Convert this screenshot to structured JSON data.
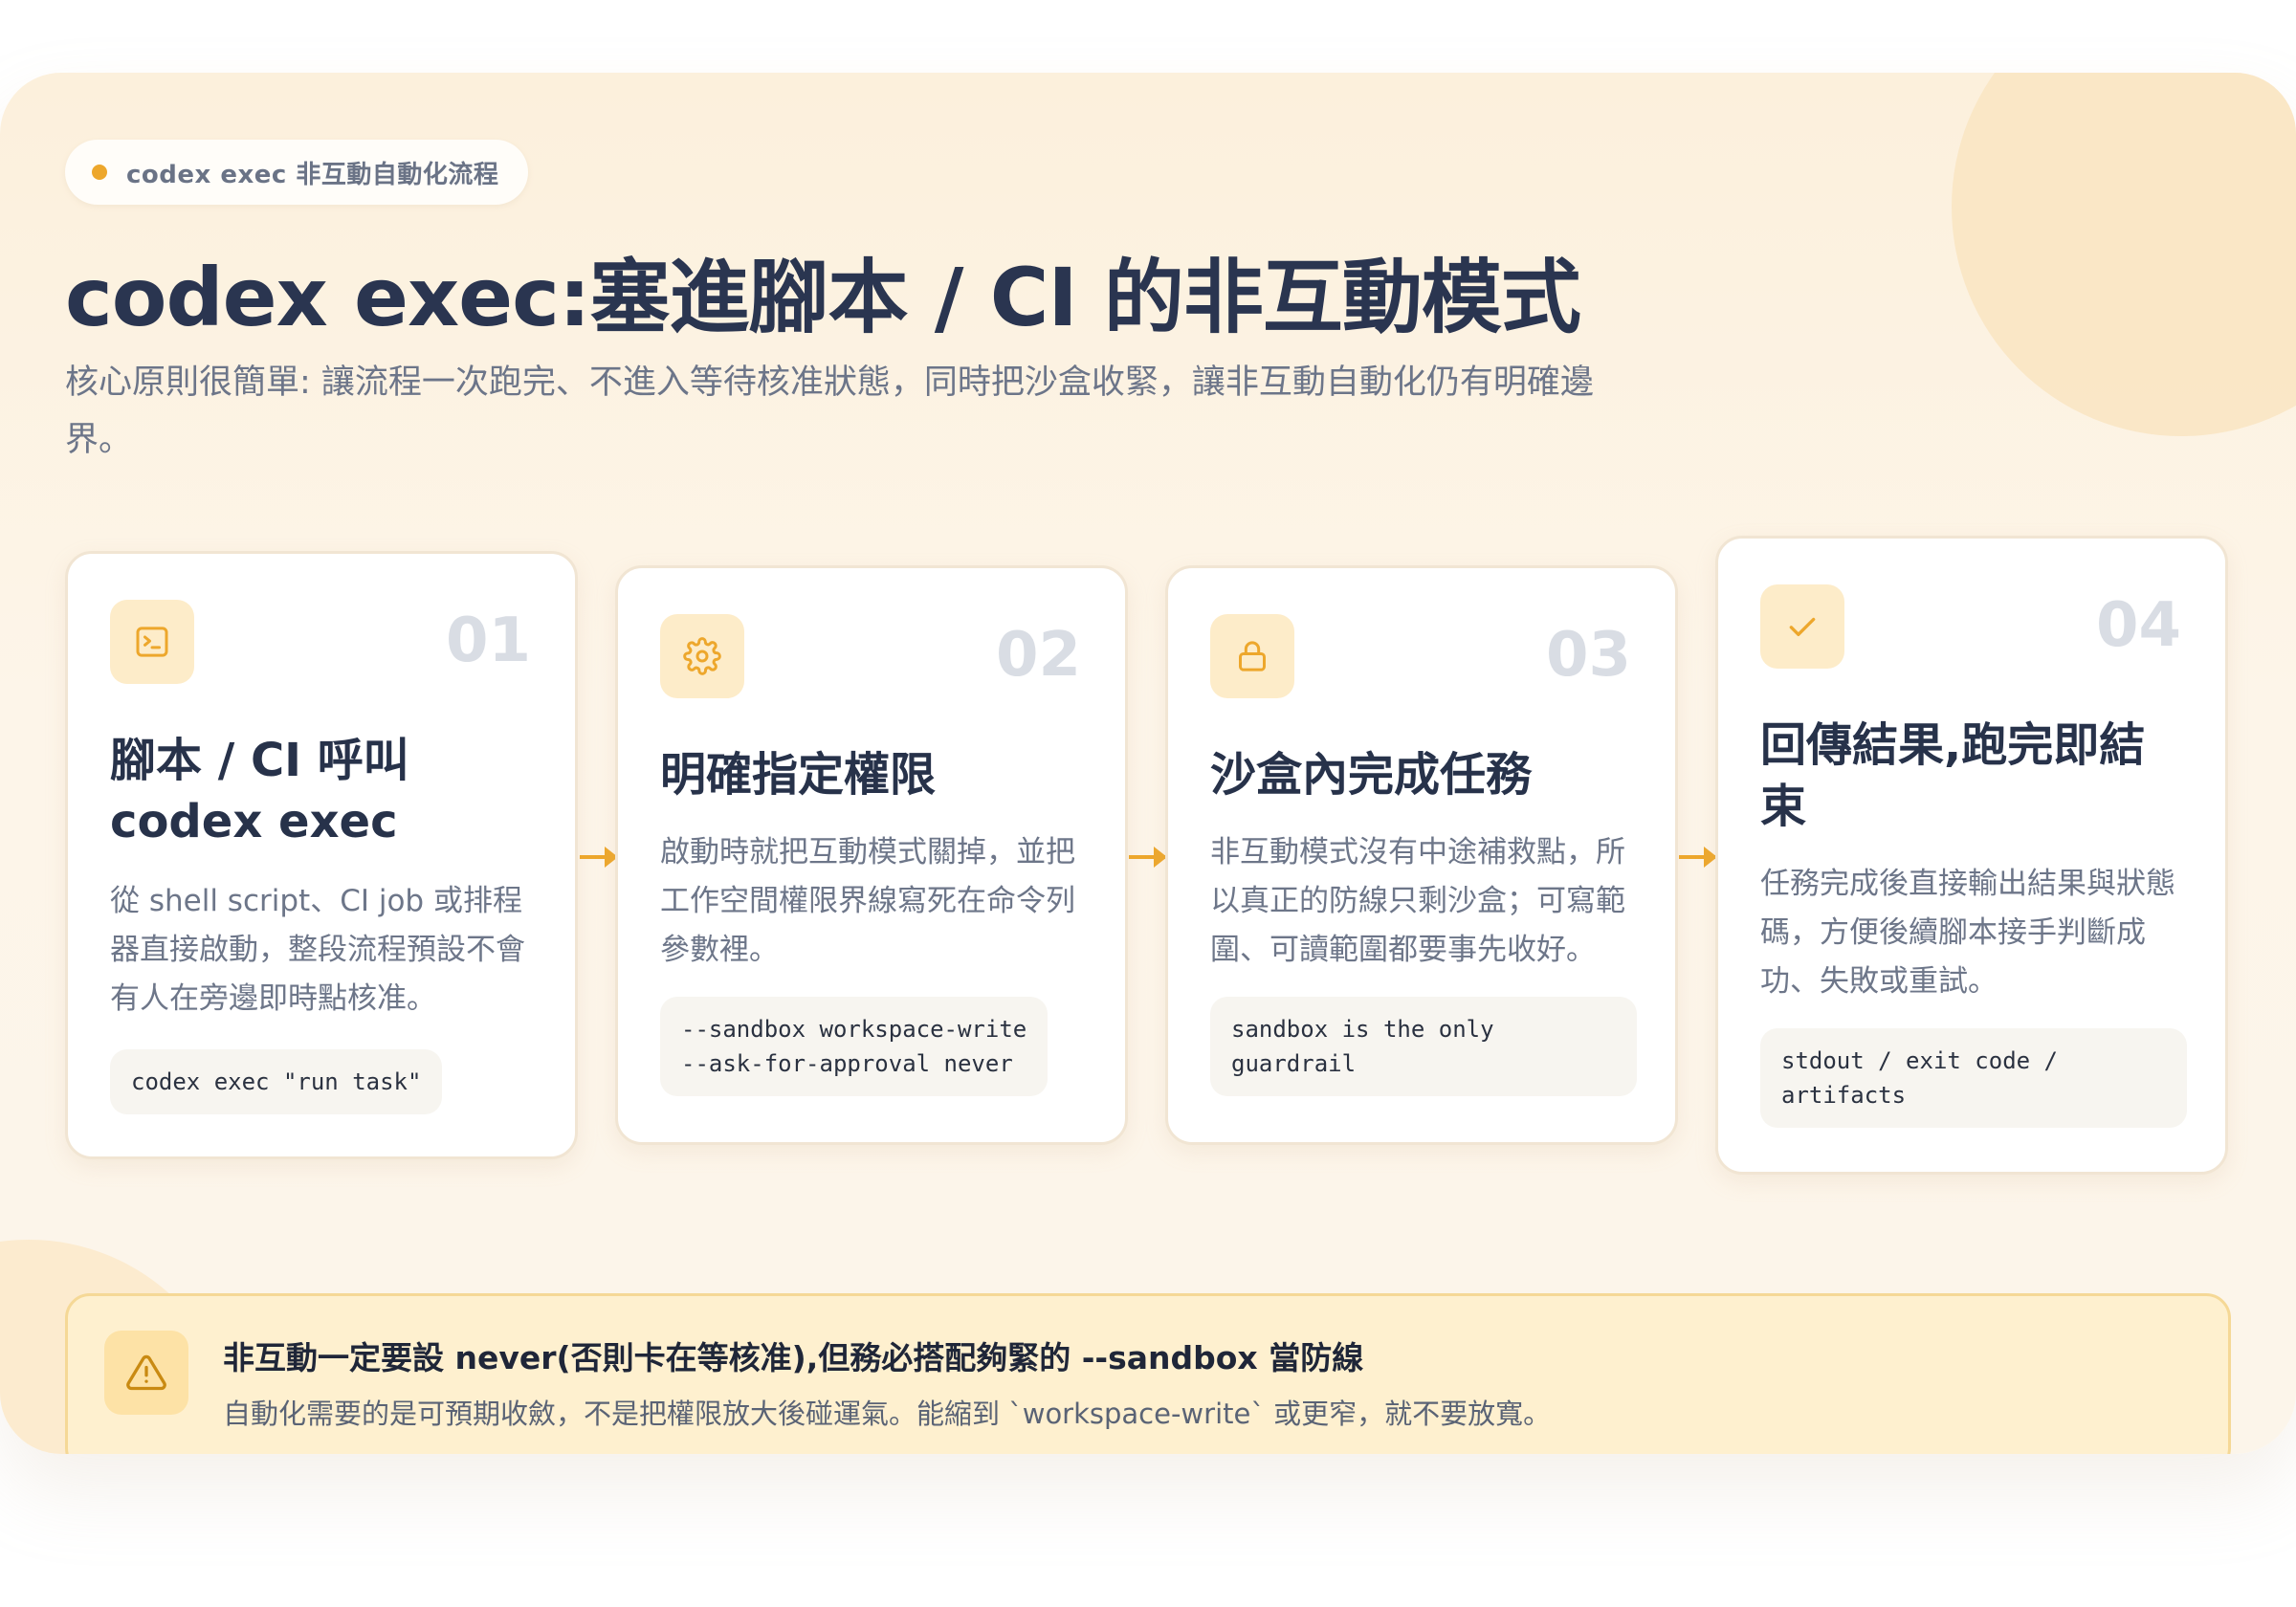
{
  "badge": {
    "label": "codex exec 非互動自動化流程"
  },
  "header": {
    "title": "codex exec:塞進腳本 / CI 的非互動模式",
    "subtitle": "核心原則很簡單: 讓流程一次跑完、不進入等待核准狀態，同時把沙盒收緊，讓非互動自動化仍有明確邊界。"
  },
  "steps": [
    {
      "number": "01",
      "icon": "terminal-icon",
      "title": "腳本 / CI 呼叫 codex exec",
      "description": "從 shell script、CI job 或排程器直接啟動，整段流程預設不會有人在旁邊即時點核准。",
      "code": "codex exec \"run task\""
    },
    {
      "number": "02",
      "icon": "gear-icon",
      "title": "明確指定權限",
      "description": "啟動時就把互動模式關掉，並把工作空間權限界線寫死在命令列參數裡。",
      "code": "--sandbox workspace-write\n--ask-for-approval never"
    },
    {
      "number": "03",
      "icon": "lock-icon",
      "title": "沙盒內完成任務",
      "description": "非互動模式沒有中途補救點，所以真正的防線只剩沙盒；可寫範圍、可讀範圍都要事先收好。",
      "code": "sandbox is the only\nguardrail"
    },
    {
      "number": "04",
      "icon": "check-icon",
      "title": "回傳結果,跑完即結束",
      "description": "任務完成後直接輸出結果與狀態碼，方便後續腳本接手判斷成功、失敗或重試。",
      "code": "stdout / exit code /\nartifacts"
    }
  ],
  "warning": {
    "icon": "warning-icon",
    "title": "非互動一定要設 never(否則卡在等核准),但務必搭配夠緊的 --sandbox 當防線",
    "description": "自動化需要的是可預期收斂，不是把權限放大後碰運氣。能縮到 `workspace-write` 或更窄，就不要放寬。"
  },
  "colors": {
    "accent": "#eda72c",
    "icon_bg": "#fdecc9",
    "title_text": "#2a3550",
    "step_number": "#d9dde4"
  }
}
